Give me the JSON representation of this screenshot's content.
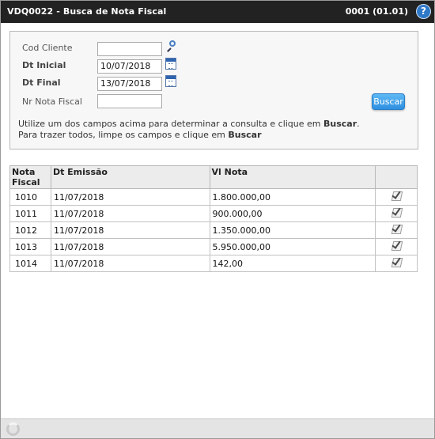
{
  "titlebar": {
    "title": "VDQ0022 - Busca de Nota Fiscal",
    "company": "0001 (01.01)",
    "help_label": "?"
  },
  "filters": {
    "cod_cliente": {
      "label": "Cod Cliente",
      "value": ""
    },
    "dt_inicial": {
      "label": "Dt Inicial",
      "value": "10/07/2018"
    },
    "dt_final": {
      "label": "Dt Final",
      "value": "13/07/2018"
    },
    "nr_nota_fiscal": {
      "label": "Nr Nota Fiscal",
      "value": ""
    },
    "search_button": "Buscar",
    "hint_line1_prefix": "Utilize um dos campos acima para determinar a consulta e clique em ",
    "hint_line1_bold": "Buscar",
    "hint_line1_suffix": ".",
    "hint_line2_prefix": "Para trazer todos, limpe os campos e clique em ",
    "hint_line2_bold": "Buscar"
  },
  "table": {
    "columns": [
      "Nota Fiscal",
      "Dt Emissão",
      "Vl Nota",
      ""
    ],
    "rows": [
      {
        "nota": "1010",
        "dt_emissao": "11/07/2018",
        "vl_nota": "1.800.000,00"
      },
      {
        "nota": "1011",
        "dt_emissao": "11/07/2018",
        "vl_nota": "900.000,00"
      },
      {
        "nota": "1012",
        "dt_emissao": "11/07/2018",
        "vl_nota": "1.350.000,00"
      },
      {
        "nota": "1013",
        "dt_emissao": "11/07/2018",
        "vl_nota": "5.950.000,00"
      },
      {
        "nota": "1014",
        "dt_emissao": "11/07/2018",
        "vl_nota": "142,00"
      }
    ]
  },
  "icons": {
    "search": "search-icon",
    "calendar": "calendar-icon",
    "select": "check-document-icon",
    "loading": "loading-spinner-icon",
    "help": "help-icon"
  }
}
